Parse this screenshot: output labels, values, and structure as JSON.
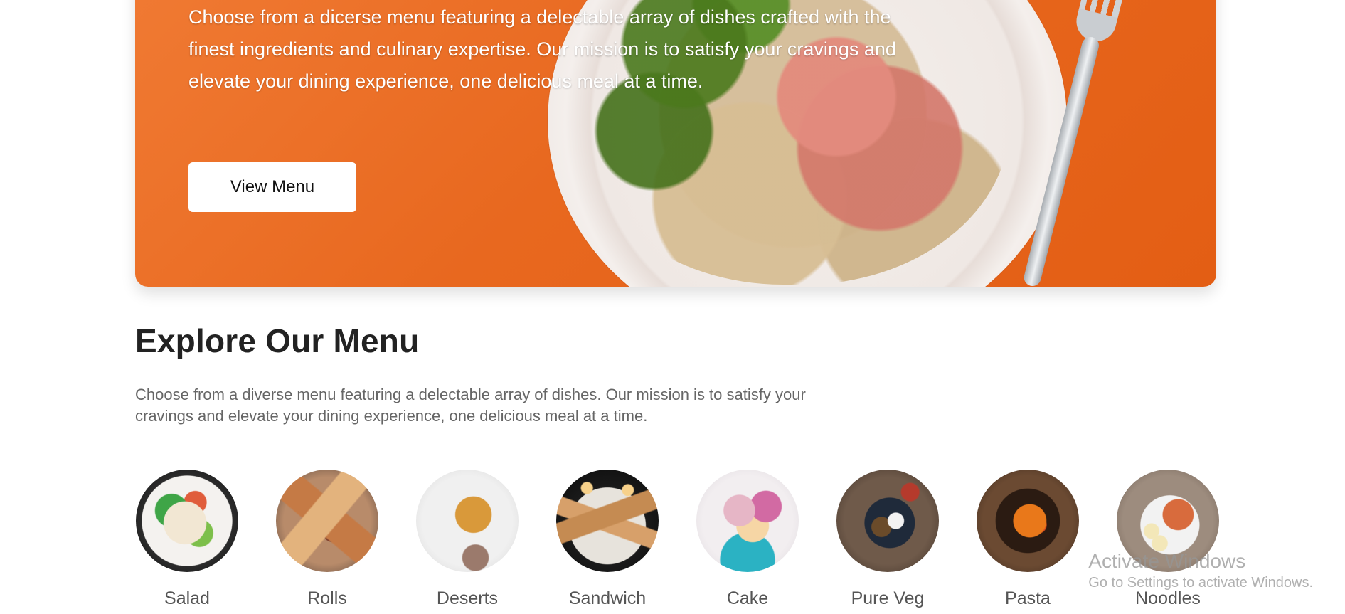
{
  "hero": {
    "text": "Choose from a dicerse menu featuring a delectable array of dishes crafted with the finest ingredients and culinary expertise. Our mission is to satisfy your cravings and elevate your dining experience, one delicious meal at a time.",
    "button_label": "View Menu",
    "background_color": "#e8681f"
  },
  "explore": {
    "title": "Explore Our Menu",
    "description": "Choose from a diverse menu featuring a delectable array of dishes. Our mission is to satisfy your cravings and elevate your dining experience, one delicious meal at a time.",
    "categories": [
      {
        "label": "Salad",
        "image": "salad-image"
      },
      {
        "label": "Rolls",
        "image": "rolls-image"
      },
      {
        "label": "Deserts",
        "image": "deserts-image"
      },
      {
        "label": "Sandwich",
        "image": "sandwich-image"
      },
      {
        "label": "Cake",
        "image": "cake-image"
      },
      {
        "label": "Pure Veg",
        "image": "pure-veg-image"
      },
      {
        "label": "Pasta",
        "image": "pasta-image"
      },
      {
        "label": "Noodles",
        "image": "noodles-image"
      }
    ]
  },
  "watermark": {
    "title": "Activate Windows",
    "subtitle": "Go to Settings to activate Windows."
  }
}
